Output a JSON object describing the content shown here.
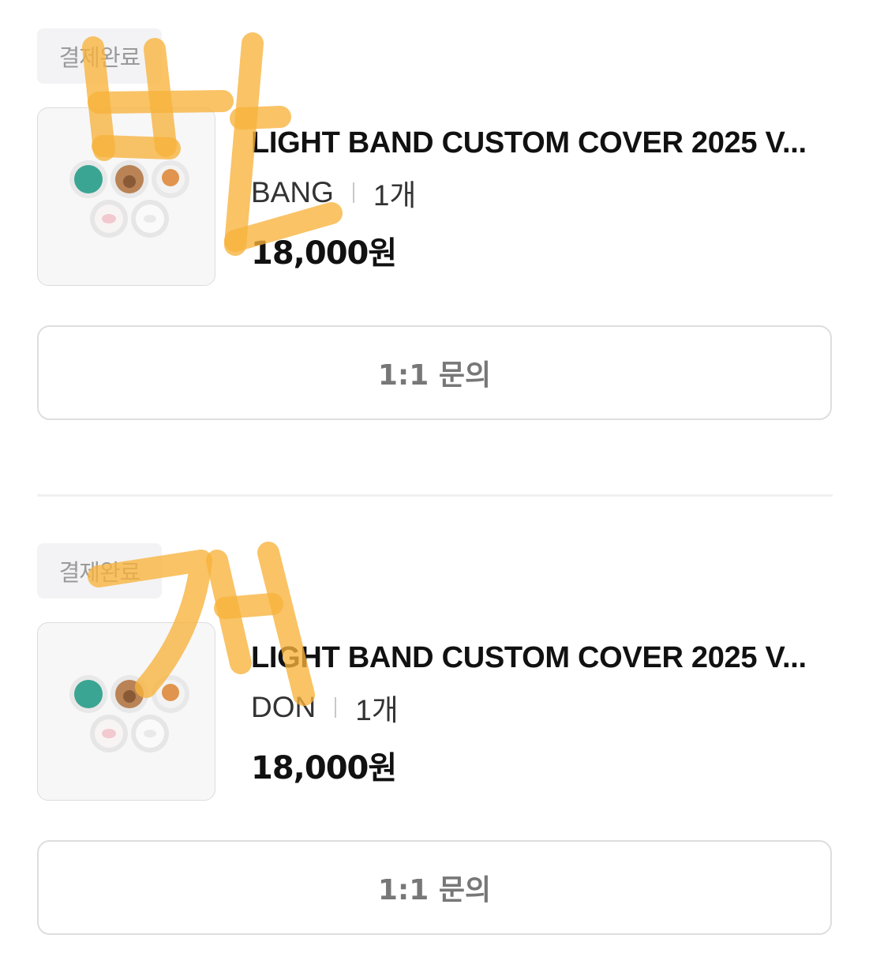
{
  "orders": [
    {
      "status": "결제완료",
      "title": "LIGHT BAND CUSTOM COVER 2025 V...",
      "option": "BANG",
      "quantity": "1개",
      "price": "18,000원",
      "inquiry_label": "1:1 문의",
      "handwriting": "번"
    },
    {
      "status": "결제완료",
      "title": "LIGHT BAND CUSTOM COVER 2025 V...",
      "option": "DON",
      "quantity": "1개",
      "price": "18,000원",
      "inquiry_label": "1:1 문의",
      "handwriting": "개"
    }
  ],
  "colors": {
    "scribble": "#f7b23b",
    "badge_bg": "#f3f3f5",
    "border": "#dedede",
    "cover_teal": "#3aa592",
    "cover_brown": "#b98356",
    "cover_orange": "#e0944d"
  },
  "icons": [
    "light-band-cover-product-image",
    "handwritten-marker-overlay"
  ]
}
